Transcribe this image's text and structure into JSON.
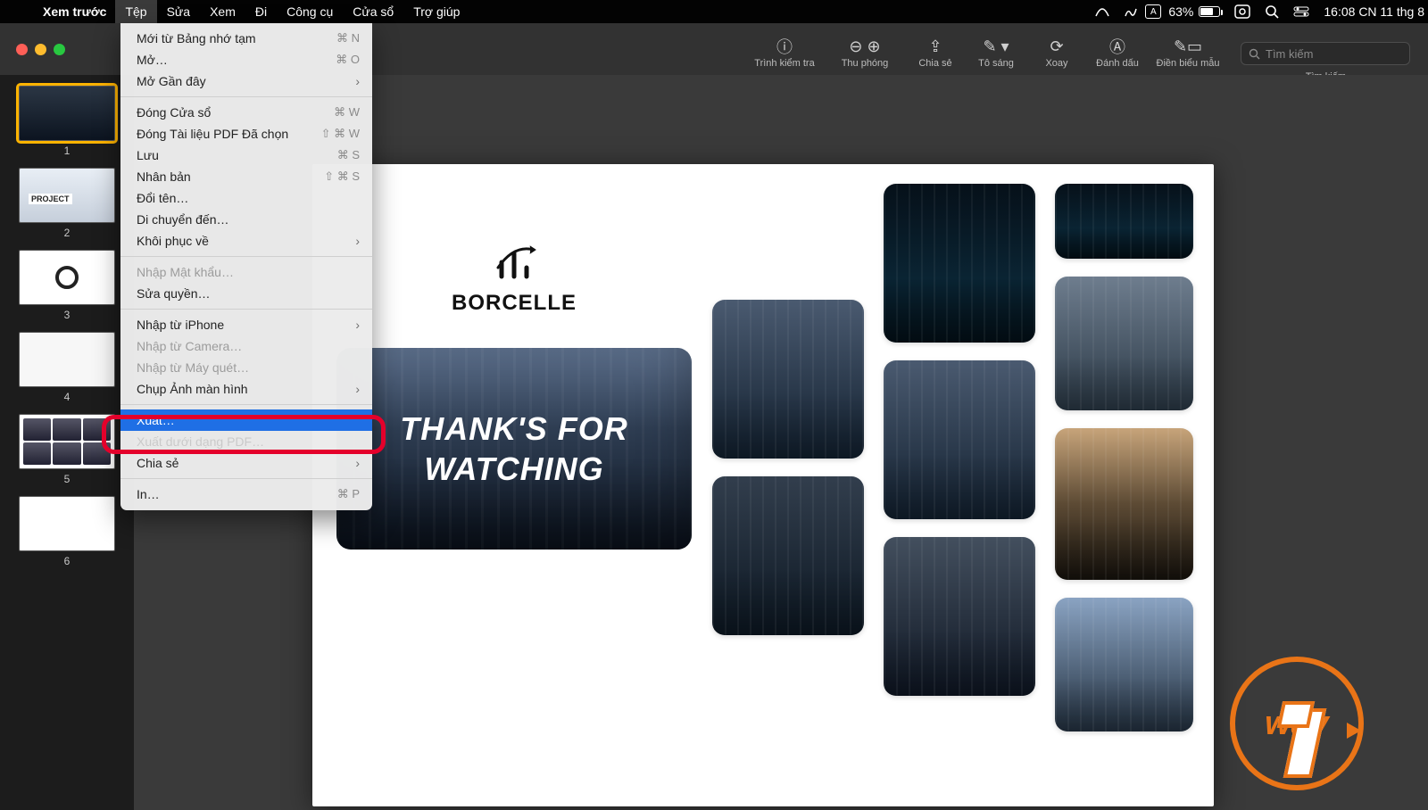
{
  "menubar": {
    "app_name": "Xem trước",
    "items": [
      "Tệp",
      "Sửa",
      "Xem",
      "Đi",
      "Công cụ",
      "Cửa sổ",
      "Trợ giúp"
    ],
    "active_index": 0,
    "battery_pct": "63%",
    "clock": "16:08 CN 11 thg 8"
  },
  "toolbar": {
    "items": [
      {
        "label": "Trình kiểm tra",
        "icon": "ⓘ"
      },
      {
        "label": "Thu phóng",
        "icon": "⊖ ⊕"
      },
      {
        "label": "Chia sẻ",
        "icon": "⇪"
      },
      {
        "label": "Tô sáng",
        "icon": "✎ ▾"
      },
      {
        "label": "Xoay",
        "icon": "⟳"
      },
      {
        "label": "Đánh dấu",
        "icon": "Ⓐ"
      },
      {
        "label": "Điền biểu mẫu",
        "icon": "✎▭"
      }
    ],
    "search_placeholder": "Tìm kiếm",
    "search_label": "Tìm kiếm"
  },
  "sidebar": {
    "pages": [
      "1",
      "2",
      "3",
      "4",
      "5",
      "6"
    ],
    "selected_index": 0
  },
  "slide": {
    "brand": "BORCELLE",
    "hero_line1": "THANK'S FOR",
    "hero_line2": "WATCHING"
  },
  "menu": {
    "groups": [
      [
        {
          "label": "Mới từ Bảng nhớ tạm",
          "shortcut": "⌘ N"
        },
        {
          "label": "Mở…",
          "shortcut": "⌘ O"
        },
        {
          "label": "Mở Gần đây",
          "submenu": true
        }
      ],
      [
        {
          "label": "Đóng Cửa sổ",
          "shortcut": "⌘ W"
        },
        {
          "label": "Đóng Tài liệu PDF Đã chọn",
          "shortcut": "⇧ ⌘ W"
        },
        {
          "label": "Lưu",
          "shortcut": "⌘ S"
        },
        {
          "label": "Nhân bản",
          "shortcut": "⇧ ⌘ S"
        },
        {
          "label": "Đổi tên…"
        },
        {
          "label": "Di chuyển đến…"
        },
        {
          "label": "Khôi phục về",
          "submenu": true
        }
      ],
      [
        {
          "label": "Nhập Mật khẩu…",
          "disabled": true
        },
        {
          "label": "Sửa quyền…"
        }
      ],
      [
        {
          "label": "Nhập từ iPhone",
          "submenu": true
        },
        {
          "label": "Nhập từ Camera…",
          "disabled": true
        },
        {
          "label": "Nhập từ Máy quét…",
          "disabled": true
        },
        {
          "label": "Chụp Ảnh màn hình",
          "submenu": true
        }
      ],
      [
        {
          "label": "Xuất…",
          "highlight": true
        },
        {
          "label": "Xuất dưới dạng PDF…",
          "obscured": true
        },
        {
          "label": "Chia sẻ",
          "submenu": true
        }
      ],
      [
        {
          "label": "In…",
          "shortcut": "⌘ P"
        }
      ]
    ]
  },
  "badge": {
    "text": "way"
  }
}
